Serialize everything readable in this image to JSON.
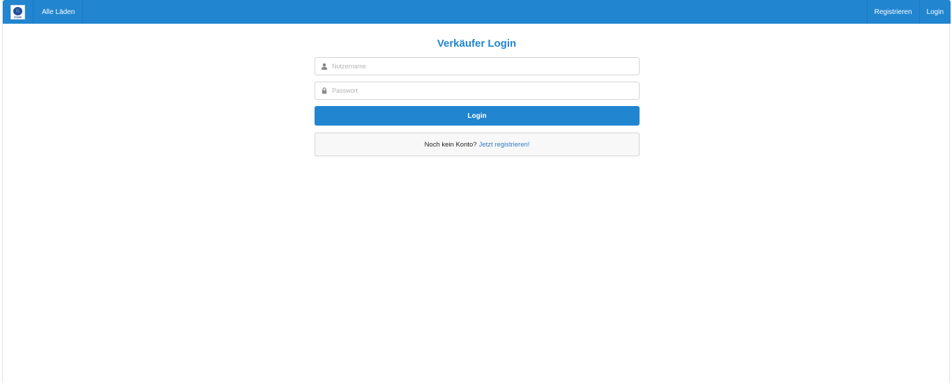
{
  "navbar": {
    "brand_logo": {
      "icon": "shop-logo-icon",
      "glyph": "♘",
      "caption": "ZONE"
    },
    "all_shops_label": "Alle Läden",
    "register_label": "Registrieren",
    "login_label": "Login"
  },
  "form": {
    "title": "Verkäufer Login",
    "username": {
      "placeholder": "Nutzername",
      "icon": "user-icon"
    },
    "password": {
      "placeholder": "Passwort",
      "icon": "lock-icon"
    },
    "submit_label": "Login",
    "register_prompt": "Noch kein Konto?",
    "register_link": "Jetzt registrieren!"
  },
  "colors": {
    "primary": "#2185d0",
    "link": "#2a7bc4"
  }
}
